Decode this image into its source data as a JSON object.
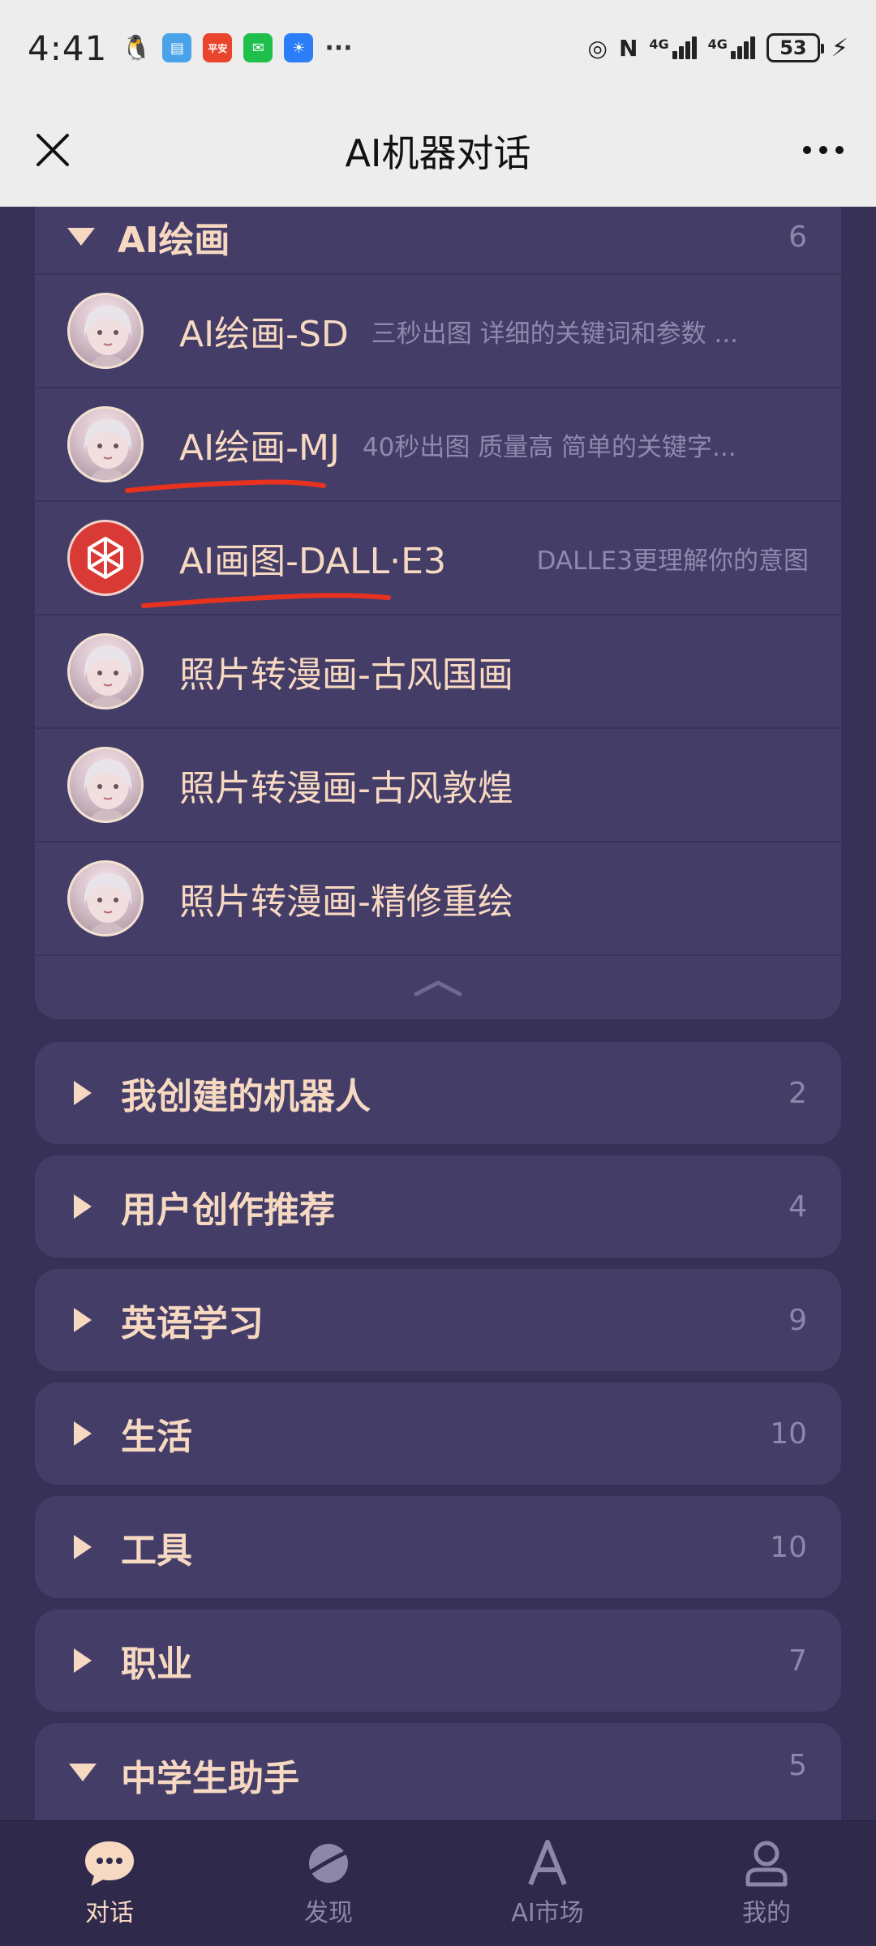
{
  "status_bar": {
    "time": "4:41",
    "notifications": [
      "qq-icon",
      "app-blue-icon",
      "app-red-icon",
      "wechat-icon",
      "bulb-icon"
    ],
    "notif_red_text": "平安",
    "more": "···",
    "signal_labels": [
      "4G",
      "4G"
    ],
    "battery": "53"
  },
  "header": {
    "title": "AI机器对话"
  },
  "expanded_category": {
    "name": "AI绘画",
    "count": "6",
    "items": [
      {
        "name": "AI绘画-SD",
        "desc": "三秒出图 详细的关键词和参数 ...",
        "avatar": "girl-avatar"
      },
      {
        "name": "AI绘画-MJ",
        "desc": "40秒出图 质量高 简单的关键字...",
        "avatar": "girl-avatar"
      },
      {
        "name": "AI画图-DALL·E3",
        "desc": "DALLE3更理解你的意图",
        "avatar": "openai-avatar"
      },
      {
        "name": "照片转漫画-古风国画",
        "desc": "",
        "avatar": "girl-avatar"
      },
      {
        "name": "照片转漫画-古风敦煌",
        "desc": "",
        "avatar": "girl-avatar"
      },
      {
        "name": "照片转漫画-精修重绘",
        "desc": "",
        "avatar": "girl-avatar"
      }
    ]
  },
  "categories": [
    {
      "name": "我创建的机器人",
      "count": "2",
      "expanded": false
    },
    {
      "name": "用户创作推荐",
      "count": "4",
      "expanded": false
    },
    {
      "name": "英语学习",
      "count": "9",
      "expanded": false
    },
    {
      "name": "生活",
      "count": "10",
      "expanded": false
    },
    {
      "name": "工具",
      "count": "10",
      "expanded": false
    },
    {
      "name": "职业",
      "count": "7",
      "expanded": false
    },
    {
      "name": "中学生助手",
      "count": "5",
      "expanded": true
    }
  ],
  "bottom_nav": [
    {
      "label": "对话",
      "icon": "chat-bubble-icon",
      "active": true
    },
    {
      "label": "发现",
      "icon": "planet-icon",
      "active": false
    },
    {
      "label": "AI市场",
      "icon": "letter-a-icon",
      "active": false
    },
    {
      "label": "我的",
      "icon": "person-icon",
      "active": false
    }
  ],
  "colors": {
    "background": "#373158",
    "card": "#433d68",
    "accent": "#f7d9c1",
    "muted": "#8d87aa",
    "annotation_underline": "#e8321e"
  }
}
